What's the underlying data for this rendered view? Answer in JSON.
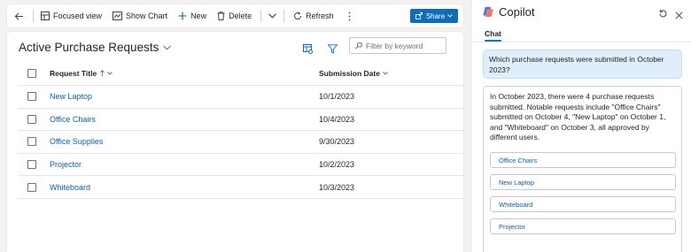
{
  "commandbar": {
    "focused_view": "Focused view",
    "show_chart": "Show Chart",
    "new": "New",
    "delete": "Delete",
    "refresh": "Refresh",
    "share": "Share"
  },
  "view": {
    "title": "Active Purchase Requests",
    "filter_placeholder": "Filter by keyword",
    "filter_value": ""
  },
  "table": {
    "columns": [
      "Request Title",
      "Submission Date"
    ],
    "rows": [
      {
        "title": "New Laptop",
        "date": "10/1/2023"
      },
      {
        "title": "Office Chairs",
        "date": "10/4/2023"
      },
      {
        "title": "Office Supplies",
        "date": "9/30/2023"
      },
      {
        "title": "Projector",
        "date": "10/2/2023"
      },
      {
        "title": "Whiteboard",
        "date": "10/3/2023"
      }
    ]
  },
  "copilot": {
    "title": "Copilot",
    "tab": "Chat",
    "user_message": "Which purchase requests were submitted in October 2023?",
    "bot_message": "In October 2023, there were 4 purchase requests submitted. Notable requests include \"Office Chairs\" submitted on October 4, \"New Laptop\" on October 1, and \"Whiteboard\" on October 3, all approved by different users.",
    "chips": [
      "Office Chairs",
      "New Laptop",
      "Whiteboard",
      "Projector"
    ]
  },
  "colors": {
    "accent": "#0f6cbd",
    "link": "#115ea3",
    "user_bubble": "#e0eefc"
  },
  "icons": [
    "back-arrow-icon",
    "focused-view-icon",
    "chart-icon",
    "plus-icon",
    "trash-icon",
    "chevron-down-icon",
    "refresh-icon",
    "more-vertical-icon",
    "share-icon",
    "table-settings-icon",
    "filter-icon",
    "search-icon",
    "sort-up-icon",
    "copilot-logo-icon",
    "reset-icon",
    "close-icon"
  ]
}
